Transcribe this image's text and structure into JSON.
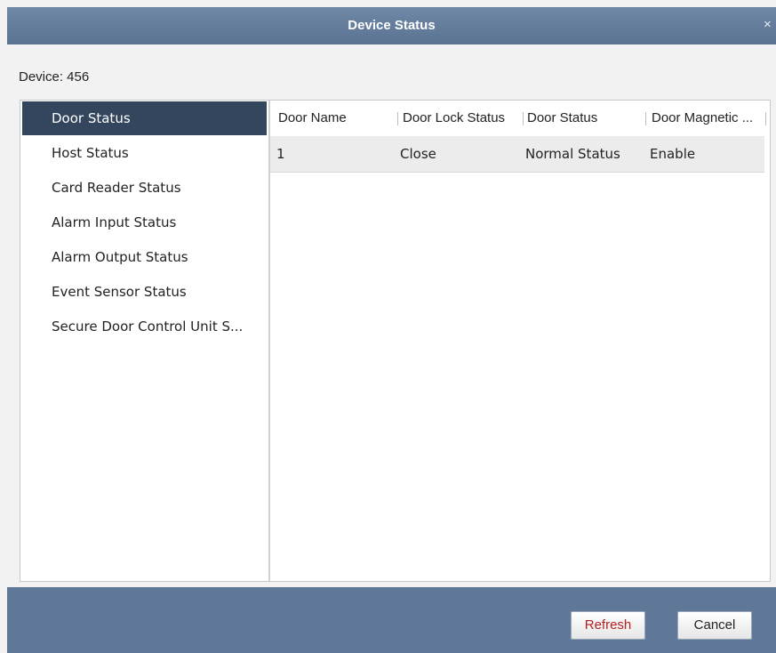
{
  "window": {
    "title": "Device Status",
    "close_glyph": "×"
  },
  "device": {
    "label": "Device: 456"
  },
  "sidebar": {
    "selected_index": 0,
    "items": [
      {
        "label": "Door Status"
      },
      {
        "label": "Host Status"
      },
      {
        "label": "Card Reader Status"
      },
      {
        "label": "Alarm Input Status"
      },
      {
        "label": "Alarm Output Status"
      },
      {
        "label": "Event Sensor Status"
      },
      {
        "label": "Secure Door Control Unit S..."
      }
    ]
  },
  "table": {
    "columns": [
      "Door Name",
      "Door Lock Status",
      "Door Status",
      "Door Magnetic ..."
    ],
    "rows": [
      [
        "1",
        "Close",
        "Normal Status",
        "Enable"
      ]
    ]
  },
  "buttons": {
    "refresh": "Refresh",
    "cancel": "Cancel"
  },
  "colors": {
    "titlebar": "#5f7897",
    "selected_item": "#34465e",
    "refresh_text": "#b22222"
  },
  "icons": {
    "close": "close-icon"
  }
}
